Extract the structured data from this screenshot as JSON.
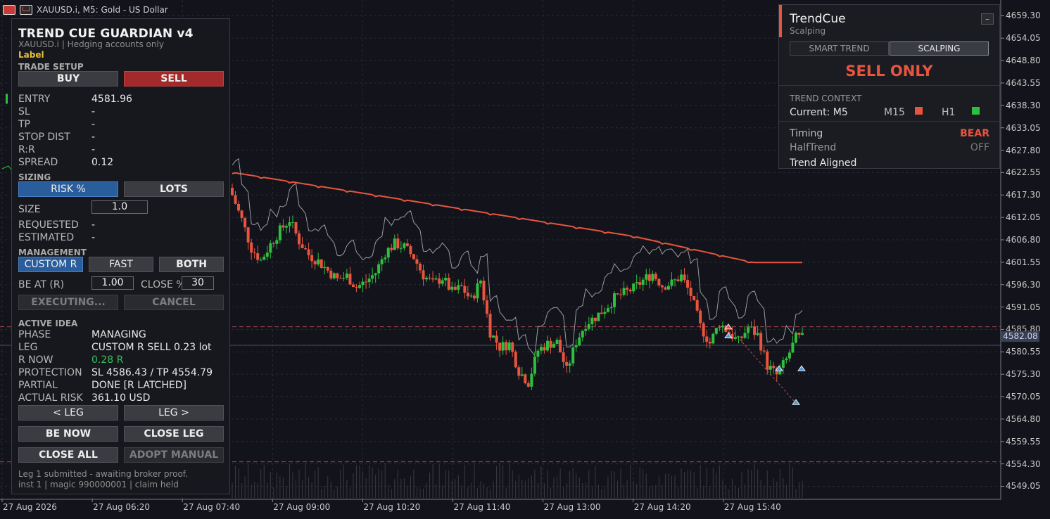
{
  "window": {
    "symbol_title": "XAUUSD.i, M5:  Gold - US Dollar"
  },
  "y_axis": {
    "labels": [
      "4659.30",
      "4654.05",
      "4648.80",
      "4643.55",
      "4638.30",
      "4633.05",
      "4627.80",
      "4622.55",
      "4617.30",
      "4612.05",
      "4606.80",
      "4601.55",
      "4596.30",
      "4591.05",
      "4585.80",
      "4580.55",
      "4575.30",
      "4570.05",
      "4564.80",
      "4559.55",
      "4554.30",
      "4549.05"
    ],
    "current_price": "4582.08"
  },
  "x_axis": {
    "labels": [
      "27 Aug 2026",
      "27 Aug 06:20",
      "27 Aug 07:40",
      "27 Aug 09:00",
      "27 Aug 10:20",
      "27 Aug 11:40",
      "27 Aug 13:00",
      "27 Aug 14:20",
      "27 Aug 15:40"
    ]
  },
  "guardian": {
    "title": "TREND CUE GUARDIAN v4",
    "subtitle": "XAUUSD.i  |  Hedging accounts only",
    "label": "Label",
    "trade_setup": {
      "heading": "TRADE SETUP",
      "buy": "BUY",
      "sell": "SELL",
      "rows": [
        {
          "k": "ENTRY",
          "v": "4581.96"
        },
        {
          "k": "SL",
          "v": "-"
        },
        {
          "k": "TP",
          "v": "-"
        },
        {
          "k": "STOP DIST",
          "v": "-"
        },
        {
          "k": "R:R",
          "v": "-"
        },
        {
          "k": "SPREAD",
          "v": "0.12"
        }
      ]
    },
    "sizing": {
      "heading": "SIZING",
      "risk_pct": "RISK %",
      "lots": "LOTS",
      "size_label": "SIZE",
      "size_value": "1.0",
      "requested_label": "REQUESTED",
      "requested_value": "-",
      "estimated_label": "ESTIMATED",
      "estimated_value": "-"
    },
    "management": {
      "heading": "MANAGEMENT",
      "custom_r": "CUSTOM R",
      "fast": "FAST",
      "both": "BOTH",
      "be_at_label": "BE AT (R)",
      "be_at_value": "1.00",
      "close_pct_label": "CLOSE %",
      "close_pct_value": "30",
      "executing": "EXECUTING...",
      "cancel": "CANCEL"
    },
    "active_idea": {
      "heading": "ACTIVE IDEA",
      "rows": [
        {
          "k": "PHASE",
          "v": "MANAGING"
        },
        {
          "k": "LEG",
          "v": "CUSTOM R  SELL  0.23 lot"
        },
        {
          "k": "R NOW",
          "v": "0.28 R"
        },
        {
          "k": "PROTECTION",
          "v": "SL 4586.43 / TP 4554.79"
        },
        {
          "k": "PARTIAL",
          "v": "DONE  [R LATCHED]"
        },
        {
          "k": "ACTUAL RISK",
          "v": "361.10 USD"
        }
      ],
      "prev_leg": "< LEG",
      "next_leg": "LEG >",
      "be_now": "BE NOW",
      "close_leg": "CLOSE LEG",
      "close_all": "CLOSE ALL",
      "adopt_manual": "ADOPT MANUAL"
    },
    "status_line1": "Leg 1 submitted - awaiting broker proof.",
    "status_line2": "inst 1 | magic 990000001 | claim held"
  },
  "trendcue": {
    "title": "TrendCue",
    "subtitle": "Scalping",
    "minimize": "–",
    "tab_smart": "SMART TREND",
    "tab_scalping": "SCALPING",
    "signal": "SELL ONLY",
    "context_heading": "TREND CONTEXT",
    "current": "Current: M5",
    "m15": "M15",
    "h1": "H1",
    "m15_color": "#e8553f",
    "h1_color": "#2fbf3f",
    "timing_label": "Timing",
    "timing_value": "BEAR",
    "halftrend_label": "HalfTrend",
    "halftrend_value": "OFF",
    "aligned": "Trend Aligned"
  },
  "colors": {
    "bull": "#2fbf3f",
    "bear": "#e8553f",
    "accent_red": "#e8553f"
  },
  "chart_data": {
    "type": "candlestick",
    "symbol": "XAUUSD.i",
    "timeframe": "M5",
    "ylim": [
      4546,
      4662
    ],
    "close_series": [
      4617.3,
      4611.5,
      4604.8,
      4602.0,
      4605.7,
      4609.0,
      4611.5,
      4606.5,
      4603.3,
      4601.8,
      4599.6,
      4597.5,
      4598.3,
      4595.7,
      4597.0,
      4599.1,
      4603.8,
      4605.9,
      4605.1,
      4602.7,
      4598.5,
      4596.5,
      4597.9,
      4594.6,
      4595.7,
      4592.7,
      4597.3,
      4585.2,
      4581.7,
      4582.4,
      4576.1,
      4573.4,
      4580.9,
      4582.4,
      4582.8,
      4576.1,
      4582.9,
      4587.2,
      4588.7,
      4590.6,
      4593.1,
      4594.3,
      4595.4,
      4597.3,
      4598.9,
      4596.1,
      4596.6,
      4598.3,
      4593.9,
      4586.5,
      4582.6,
      4587.3,
      4585.0,
      4582.9,
      4586.3,
      4584.5,
      4577.3,
      4575.1,
      4578.7,
      4583.8
    ]
  }
}
